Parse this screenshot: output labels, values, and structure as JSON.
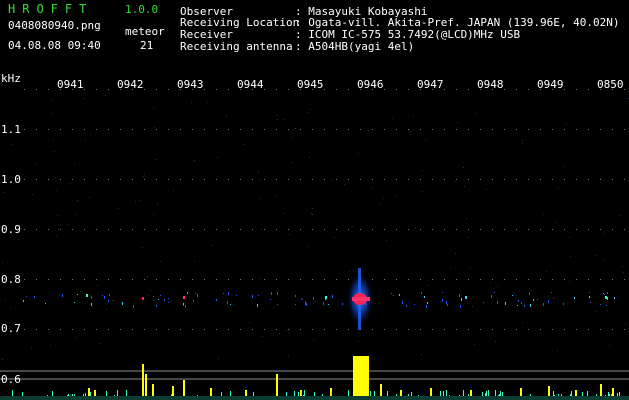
{
  "app": {
    "name": "HROFFT",
    "version": "1.0.0"
  },
  "file": {
    "name": "0408080940.png",
    "datetime": "04.08.08 09:40"
  },
  "meteor": {
    "label": "meteor",
    "count": "21"
  },
  "station": [
    {
      "key": "Observer",
      "value": ": Masayuki Kobayashi"
    },
    {
      "key": "Receiving Location",
      "value": ": Ogata-vill. Akita-Pref. JAPAN (139.96E, 40.02N)"
    },
    {
      "key": "Receiver",
      "value": ": ICOM IC-575 53.7492(@LCD)MHz USB"
    },
    {
      "key": "Receiving antenna",
      "value": ": A504HB(yagi 4el)"
    }
  ],
  "axis": {
    "unit": "kHz",
    "time_ticks": [
      "0941",
      "0942",
      "0943",
      "0944",
      "0945",
      "0946",
      "0947",
      "0948",
      "0949",
      "0850"
    ],
    "freq_ticks": [
      "1.1",
      "1.0",
      "0.9",
      "0.8",
      "0.7",
      "0.6"
    ]
  },
  "colors": {
    "accent": "#33dd33",
    "echo_core": "#ff2255",
    "echo_halo": "#2266ff",
    "detection_bar": "#ffff00",
    "baseline": "#33ffcc"
  }
}
